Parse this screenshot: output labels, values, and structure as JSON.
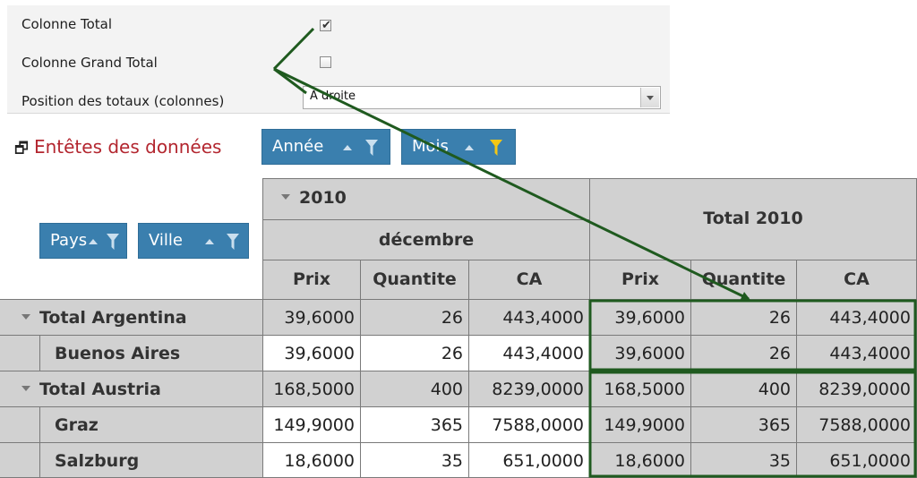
{
  "options": {
    "colonne_total_label": "Colonne Total",
    "colonne_total_checked": true,
    "colonne_grand_total_label": "Colonne Grand Total",
    "colonne_grand_total_checked": false,
    "position_label": "Position des totaux (colonnes)",
    "position_value": "A droite"
  },
  "fields": {
    "data_headers_label": "Entêtes des données",
    "column_fields": [
      "Année",
      "Mois"
    ],
    "row_fields": [
      "Pays",
      "Ville"
    ]
  },
  "grid": {
    "year": "2010",
    "month": "décembre",
    "total_header": "Total 2010",
    "measures": [
      "Prix",
      "Quantite",
      "CA"
    ],
    "rows": [
      {
        "label": "Total Argentina",
        "type": "total",
        "values": [
          "39,6000",
          "26",
          "443,4000"
        ],
        "totals": [
          "39,6000",
          "26",
          "443,4000"
        ]
      },
      {
        "label": "Buenos Aires",
        "type": "city",
        "values": [
          "39,6000",
          "26",
          "443,4000"
        ],
        "totals": [
          "39,6000",
          "26",
          "443,4000"
        ]
      },
      {
        "label": "Total Austria",
        "type": "total",
        "values": [
          "168,5000",
          "400",
          "8239,0000"
        ],
        "totals": [
          "168,5000",
          "400",
          "8239,0000"
        ]
      },
      {
        "label": "Graz",
        "type": "city",
        "values": [
          "149,9000",
          "365",
          "7588,0000"
        ],
        "totals": [
          "149,9000",
          "365",
          "7588,0000"
        ]
      },
      {
        "label": "Salzburg",
        "type": "city",
        "values": [
          "18,6000",
          "35",
          "651,0000"
        ],
        "totals": [
          "18,6000",
          "35",
          "651,0000"
        ]
      }
    ]
  },
  "colors": {
    "annotation": "#1f5a1f",
    "pill_bg": "#3a7fae",
    "header_bg": "#d1d1d1",
    "filter_active": "#f3c614",
    "filter_inactive": "#c9dfee",
    "data_headers_text": "#b3262f"
  }
}
